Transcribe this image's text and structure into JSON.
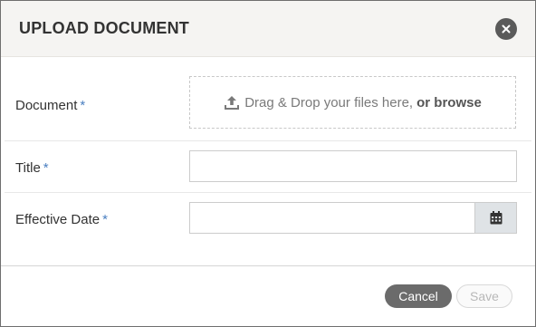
{
  "dialog": {
    "title": "UPLOAD DOCUMENT"
  },
  "form": {
    "required_marker": "*",
    "document": {
      "label": "Document",
      "dropzone_text": "Drag & Drop your files here,",
      "browse_text": "or browse",
      "icon": "upload-icon"
    },
    "title_field": {
      "label": "Title",
      "value": ""
    },
    "effective_date": {
      "label": "Effective Date",
      "value": "",
      "icon": "calendar-icon"
    }
  },
  "footer": {
    "cancel_label": "Cancel",
    "save_label": "Save"
  },
  "colors": {
    "header_bg": "#f5f4f2",
    "required": "#4a7fc1",
    "cancel_bg": "#6b6b6b",
    "calendar_bg": "#dfe3e6"
  }
}
